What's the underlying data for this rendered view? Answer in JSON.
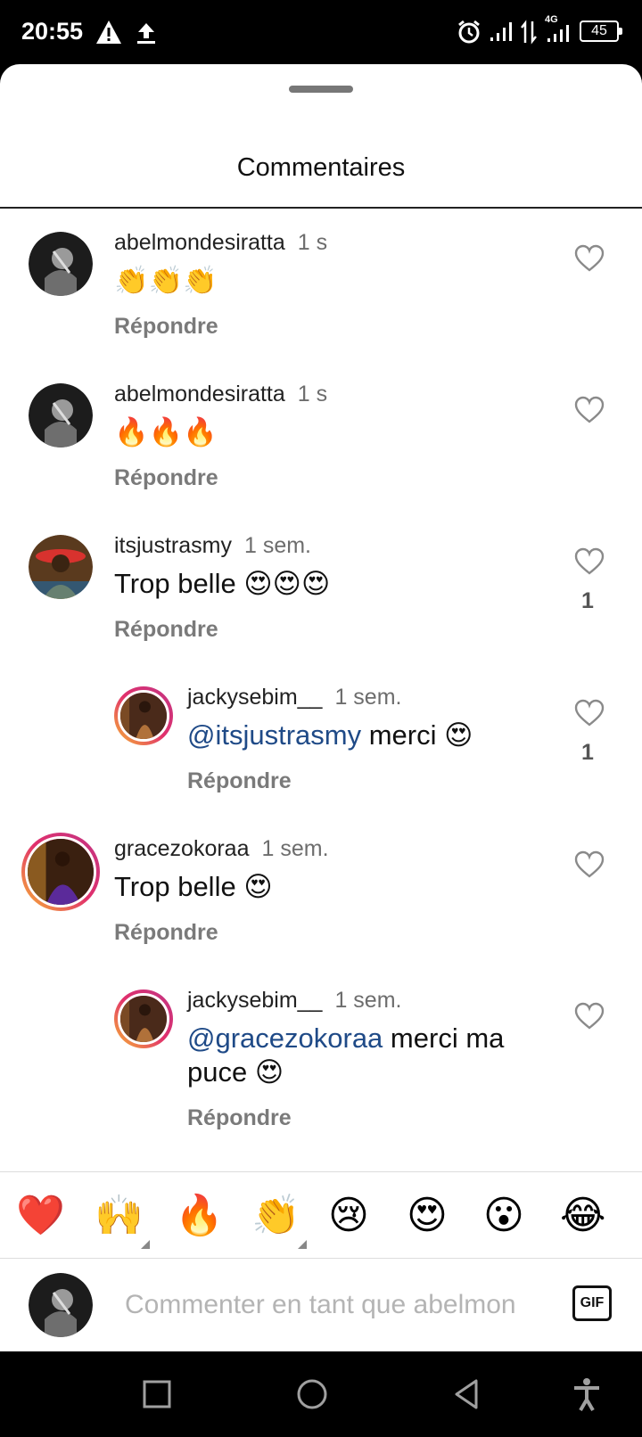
{
  "status_bar": {
    "time": "20:55",
    "network": "4G",
    "battery": "45",
    "icons": [
      "warning-icon",
      "upload-icon",
      "alarm-icon",
      "signal-icon",
      "data-arrows-icon",
      "signal-4g-icon",
      "battery-icon"
    ]
  },
  "sheet": {
    "title": "Commentaires"
  },
  "comments": [
    {
      "username": "abelmondesiratta",
      "time": "1 s",
      "text": "👏👏👏",
      "reply": "Répondre",
      "likes": ""
    },
    {
      "username": "abelmondesiratta",
      "time": "1 s",
      "text": "🔥🔥🔥",
      "reply": "Répondre",
      "likes": ""
    },
    {
      "username": "itsjustrasmy",
      "time": "1 sem.",
      "text": "Trop belle 😍😍😍",
      "reply": "Répondre",
      "likes": "1"
    },
    {
      "username": "jackysebim__",
      "time": "1 sem.",
      "mention": "@itsjustrasmy",
      "text": " merci 😍",
      "reply": "Répondre",
      "likes": "1"
    },
    {
      "username": "gracezokoraa",
      "time": "1 sem.",
      "text": "Trop belle 😍",
      "reply": "Répondre",
      "likes": ""
    },
    {
      "username": "jackysebim__",
      "time": "1 sem.",
      "mention": "@gracezokoraa",
      "text": " merci ma puce 😍",
      "reply": "Répondre",
      "likes": ""
    }
  ],
  "quick_reactions": [
    "❤️",
    "🙌",
    "🔥",
    "👏",
    "😢",
    "😍",
    "😮",
    "😂"
  ],
  "composer": {
    "placeholder": "Commenter en tant que abelmon",
    "gif_label": "GIF"
  },
  "nav_bar": {
    "icons": [
      "recent-apps-icon",
      "home-icon",
      "back-icon",
      "accessibility-icon"
    ]
  },
  "colors": {
    "mention": "#1f4a87",
    "reply": "#7a7a7a",
    "story_ring_start": "#f7b733",
    "story_ring_end": "#c13584"
  }
}
